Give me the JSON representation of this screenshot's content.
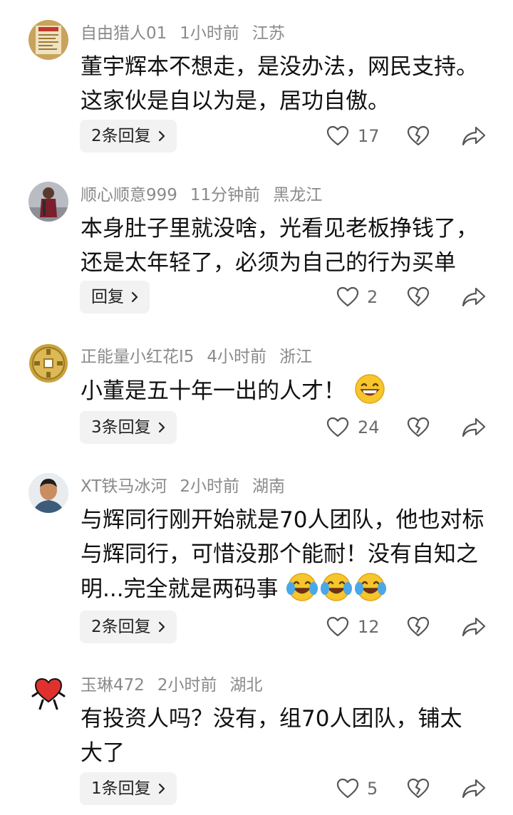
{
  "comments": [
    {
      "username": "自由猎人01",
      "time": "1小时前",
      "location": "江苏",
      "text": "董宇辉本不想走，是没办法，网民支持。这家伙是自以为是，居功自傲。",
      "reply_label": "2条回复",
      "likes": "17",
      "avatar": "poster-avatar"
    },
    {
      "username": "顺心顺意999",
      "time": "11分钟前",
      "location": "黑龙江",
      "text": "本身肚子里就没啥，光看见老板挣钱了，还是太年轻了，必须为自己的行为买单",
      "reply_label": "回复",
      "likes": "2",
      "avatar": "person-avatar"
    },
    {
      "username": "正能量小红花I5",
      "time": "4小时前",
      "location": "浙江",
      "text": "小董是五十年一出的人才！",
      "reply_label": "3条回复",
      "likes": "24",
      "avatar": "coin-avatar",
      "emojis": [
        "grin-emoji"
      ]
    },
    {
      "username": "XT铁马冰河",
      "time": "2小时前",
      "location": "湖南",
      "text": "与辉同行刚开始就是70人团队，他也对标与辉同行，可惜没那个能耐！没有自知之明...完全就是两码事",
      "reply_label": "2条回复",
      "likes": "12",
      "avatar": "man-avatar",
      "emojis": [
        "tears-of-joy-emoji",
        "tears-of-joy-emoji",
        "tears-of-joy-emoji"
      ]
    },
    {
      "username": "玉琳472",
      "time": "2小时前",
      "location": "湖北",
      "text": "有投资人吗？没有，组70人团队，铺太大了",
      "reply_label": "1条回复",
      "likes": "5",
      "avatar": "heart-avatar"
    }
  ],
  "icons": {
    "like": "heart-outline-icon",
    "dislike": "broken-heart-icon",
    "share": "share-arrow-icon",
    "reply_chevron": "chevron-right-icon"
  },
  "colors": {
    "meta_text": "#8a8a8a",
    "body_text": "#111111",
    "reply_bg": "#f2f2f2",
    "icon": "#555555"
  }
}
